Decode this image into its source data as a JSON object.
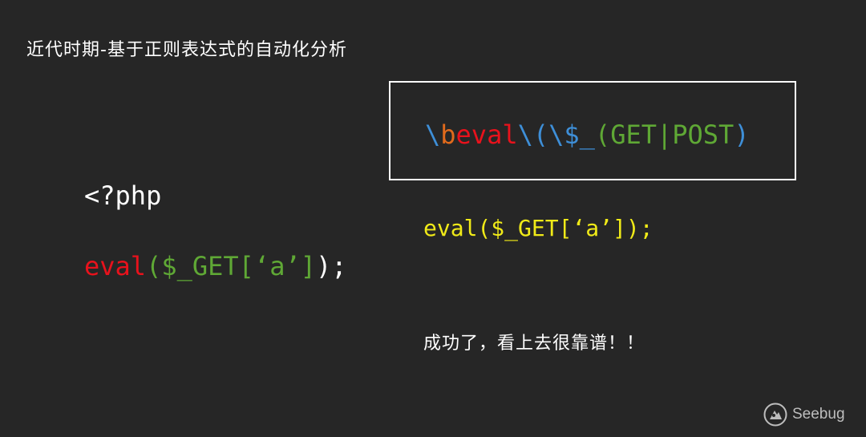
{
  "title": "近代时期-基于正则表达式的自动化分析",
  "left_code": {
    "line1": "<?php",
    "line2": {
      "kw": "eval",
      "open": "(",
      "arg": "$_GET[‘a’]",
      "close": ");"
    }
  },
  "regex": {
    "p1": "\\",
    "p2": "b",
    "p3": "eval",
    "p4": "\\(\\",
    "p5": "$_",
    "p6": "(",
    "p7": "GET",
    "p8": "|",
    "p9": "POST",
    "p10": ")"
  },
  "right_code": "eval($_GET[‘a’]);",
  "note": "成功了，看上去很靠谱！！",
  "logo_text": "Seebug",
  "colors": {
    "background": "#262626",
    "keyword_red": "#e8121c",
    "string_green": "#5fa835",
    "regex_blue": "#3e8fd8",
    "regex_orange": "#e06a1c",
    "highlight_yellow": "#f0ea18"
  }
}
